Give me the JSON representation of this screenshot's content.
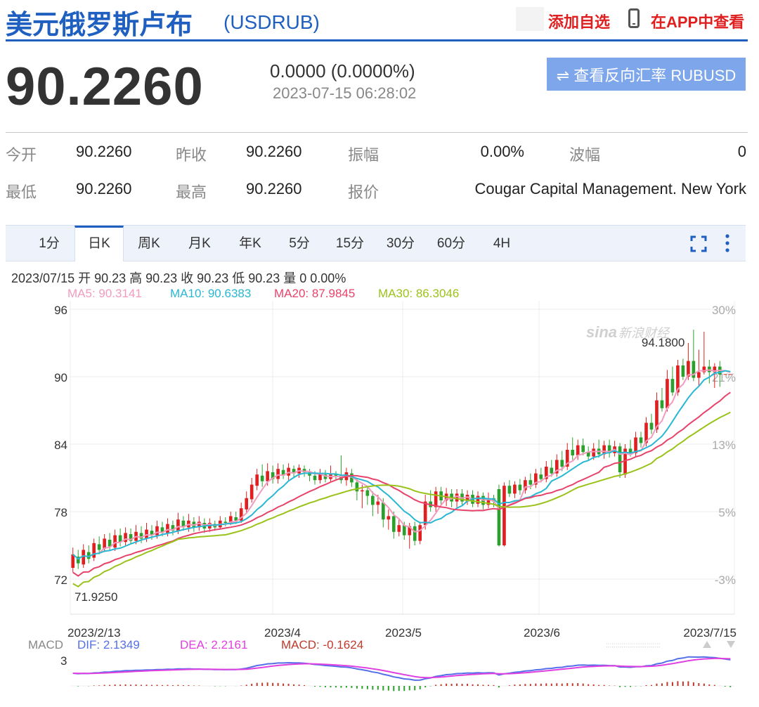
{
  "header": {
    "title": "美元俄罗斯卢布",
    "code": "(USDRUB)",
    "add_watchlist": "添加自选",
    "view_in_app": "在APP中查看"
  },
  "quote": {
    "price": "90.2260",
    "change": "0.0000 (0.0000%)",
    "timestamp": "2023-07-15 06:28:02",
    "reverse_button": "⇌ 查看反向汇率 RUBUSD"
  },
  "stats": [
    {
      "label": "今开",
      "value": "90.2260"
    },
    {
      "label": "昨收",
      "value": "90.2260"
    },
    {
      "label": "振幅",
      "value": "0.00%"
    },
    {
      "label": "波幅",
      "value": "0"
    },
    {
      "label": "最低",
      "value": "90.2260"
    },
    {
      "label": "最高",
      "value": "90.2260"
    },
    {
      "label": "报价",
      "value": "Cougar Capital Management. New York"
    }
  ],
  "tabs": [
    "1分",
    "日K",
    "周K",
    "月K",
    "年K",
    "5分",
    "15分",
    "30分",
    "60分",
    "4H"
  ],
  "active_tab": "日K",
  "info_line": "2023/07/15 开 90.23 高 90.23 收 90.23 低 90.23 量 0 0.00%",
  "ma_labels": [
    {
      "text": "MA5: 90.3141",
      "color": "#f29bbf"
    },
    {
      "text": "MA10: 90.6383",
      "color": "#29b7d3"
    },
    {
      "text": "MA20: 87.9845",
      "color": "#e8436a"
    },
    {
      "text": "MA30: 86.3046",
      "color": "#9bc21a"
    }
  ],
  "macd_labels": {
    "name": "MACD",
    "dif": "DIF: 2.1349",
    "dea": "DEA: 2.2161",
    "macd": "MACD: -0.1624",
    "axis_max": "3"
  },
  "watermark": {
    "logo": "sina",
    "text": "新浪财经"
  },
  "colors": {
    "brand_blue": "#1f5fbf",
    "up": "#e02020",
    "down": "#2ca02c",
    "ma5": "#f29bbf",
    "ma10": "#29b7d3",
    "ma20": "#e8436a",
    "ma30": "#9bc21a",
    "dif": "#5470e8",
    "dea": "#e040e0"
  },
  "chart_data": {
    "type": "candlestick",
    "y_ticks": [
      "96",
      "90",
      "84",
      "78",
      "72"
    ],
    "y_range": [
      69.5,
      96
    ],
    "pct_ticks": [
      "30%",
      "21%",
      "13%",
      "5%",
      "-3%"
    ],
    "x_ticks": [
      "2023/2/13",
      "2023/4",
      "2023/5",
      "2023/6",
      "2023/7/15"
    ],
    "annotations": {
      "max": "94.1800",
      "min": "71.9250"
    },
    "candles": [
      [
        73.0,
        74.2,
        74.8,
        72.6
      ],
      [
        74.0,
        73.4,
        74.6,
        72.9
      ],
      [
        73.3,
        74.6,
        75.1,
        73.0
      ],
      [
        74.4,
        73.8,
        75.0,
        73.4
      ],
      [
        73.9,
        75.2,
        75.6,
        73.6
      ],
      [
        75.1,
        74.6,
        75.8,
        74.2
      ],
      [
        74.7,
        75.6,
        76.0,
        74.4
      ],
      [
        75.5,
        74.9,
        76.1,
        74.6
      ],
      [
        74.8,
        75.9,
        76.4,
        74.5
      ],
      [
        75.9,
        75.3,
        76.5,
        74.9
      ],
      [
        75.3,
        76.1,
        76.6,
        75.0
      ],
      [
        76.0,
        75.4,
        76.5,
        75.1
      ],
      [
        75.4,
        76.2,
        76.8,
        75.1
      ],
      [
        76.1,
        75.6,
        76.7,
        75.2
      ],
      [
        75.6,
        76.4,
        77.0,
        75.3
      ],
      [
        76.3,
        75.9,
        76.8,
        75.5
      ],
      [
        75.9,
        76.7,
        77.2,
        75.6
      ],
      [
        76.6,
        76.1,
        77.1,
        75.8
      ],
      [
        76.1,
        76.9,
        77.4,
        75.8
      ],
      [
        76.8,
        76.3,
        77.2,
        75.9
      ],
      [
        76.3,
        77.3,
        77.9,
        76.0
      ],
      [
        77.2,
        76.6,
        77.6,
        76.3
      ],
      [
        76.6,
        77.2,
        77.8,
        76.2
      ],
      [
        77.1,
        76.6,
        77.5,
        76.2
      ],
      [
        76.6,
        77.1,
        77.6,
        76.3
      ],
      [
        77.0,
        76.5,
        77.4,
        76.1
      ],
      [
        76.5,
        77.0,
        77.4,
        76.2
      ],
      [
        76.9,
        76.6,
        77.2,
        76.3
      ],
      [
        76.6,
        77.2,
        77.6,
        76.4
      ],
      [
        77.1,
        77.0,
        77.5,
        76.7
      ],
      [
        77.0,
        77.6,
        78.0,
        76.8
      ],
      [
        77.5,
        77.2,
        78.0,
        76.9
      ],
      [
        77.2,
        78.3,
        78.8,
        77.0
      ],
      [
        78.2,
        79.2,
        79.8,
        77.9
      ],
      [
        79.1,
        80.4,
        81.0,
        78.8
      ],
      [
        80.3,
        81.3,
        81.8,
        79.9
      ],
      [
        81.2,
        80.7,
        82.2,
        80.2
      ],
      [
        80.7,
        81.6,
        82.3,
        80.3
      ],
      [
        81.5,
        80.9,
        82.1,
        80.5
      ],
      [
        80.9,
        81.8,
        82.3,
        80.5
      ],
      [
        81.7,
        81.2,
        82.2,
        80.9
      ],
      [
        81.2,
        81.9,
        82.3,
        80.8
      ],
      [
        81.8,
        81.4,
        82.1,
        81.0
      ],
      [
        81.4,
        81.9,
        82.2,
        81.0
      ],
      [
        81.8,
        81.5,
        82.1,
        81.1
      ],
      [
        81.5,
        81.2,
        81.8,
        80.7
      ],
      [
        81.2,
        80.8,
        81.6,
        80.4
      ],
      [
        80.8,
        81.4,
        81.8,
        80.5
      ],
      [
        81.3,
        80.9,
        81.7,
        80.6
      ],
      [
        80.9,
        81.3,
        82.1,
        80.6
      ],
      [
        81.3,
        81.2,
        81.6,
        80.8
      ],
      [
        81.2,
        80.8,
        83.0,
        80.5
      ],
      [
        80.8,
        81.5,
        81.9,
        80.3
      ],
      [
        81.4,
        80.6,
        81.8,
        80.2
      ],
      [
        80.6,
        79.8,
        81.0,
        79.0
      ],
      [
        79.8,
        79.9,
        80.4,
        78.3
      ],
      [
        79.9,
        79.4,
        80.3,
        78.6
      ],
      [
        79.4,
        78.6,
        79.8,
        77.6
      ],
      [
        78.6,
        78.9,
        79.5,
        77.8
      ],
      [
        78.8,
        77.3,
        79.2,
        76.6
      ],
      [
        77.3,
        77.6,
        78.2,
        76.4
      ],
      [
        77.6,
        76.2,
        78.0,
        75.6
      ],
      [
        76.2,
        76.8,
        77.3,
        75.8
      ],
      [
        76.8,
        75.9,
        77.1,
        75.5
      ],
      [
        75.9,
        76.7,
        77.0,
        74.7
      ],
      [
        76.7,
        75.4,
        77.1,
        75.0
      ],
      [
        75.4,
        76.8,
        77.1,
        75.1
      ],
      [
        76.8,
        78.9,
        79.5,
        76.4
      ],
      [
        78.9,
        78.4,
        79.9,
        78.0
      ],
      [
        78.4,
        79.8,
        80.2,
        78.0
      ],
      [
        79.8,
        79.0,
        80.2,
        78.6
      ],
      [
        79.0,
        79.6,
        80.1,
        78.5
      ],
      [
        79.6,
        78.9,
        80.0,
        78.4
      ],
      [
        78.9,
        79.6,
        80.0,
        78.4
      ],
      [
        79.6,
        78.9,
        80.0,
        78.5
      ],
      [
        78.9,
        79.5,
        79.9,
        78.6
      ],
      [
        79.5,
        78.7,
        79.9,
        78.4
      ],
      [
        78.7,
        79.4,
        79.8,
        78.4
      ],
      [
        79.4,
        78.6,
        79.7,
        78.2
      ],
      [
        78.6,
        79.2,
        79.7,
        78.3
      ],
      [
        79.2,
        78.9,
        79.5,
        78.4
      ],
      [
        80.0,
        75.0,
        80.4,
        74.9
      ],
      [
        75.0,
        80.3,
        80.6,
        74.9
      ],
      [
        80.3,
        79.6,
        80.8,
        79.3
      ],
      [
        79.6,
        80.4,
        80.7,
        79.2
      ],
      [
        80.4,
        79.9,
        80.9,
        79.5
      ],
      [
        79.9,
        80.8,
        81.1,
        79.6
      ],
      [
        80.8,
        80.4,
        81.4,
        80.0
      ],
      [
        80.4,
        81.4,
        81.8,
        80.1
      ],
      [
        81.3,
        80.9,
        81.9,
        80.6
      ],
      [
        80.9,
        82.0,
        82.5,
        80.6
      ],
      [
        81.9,
        81.4,
        82.6,
        81.1
      ],
      [
        81.4,
        82.6,
        83.1,
        81.1
      ],
      [
        82.6,
        82.0,
        83.4,
        81.6
      ],
      [
        82.0,
        83.5,
        84.1,
        81.7
      ],
      [
        83.5,
        83.0,
        84.6,
        82.6
      ],
      [
        83.0,
        83.9,
        84.4,
        82.6
      ],
      [
        83.9,
        83.3,
        84.5,
        83.0
      ],
      [
        83.3,
        82.9,
        83.8,
        82.5
      ],
      [
        82.9,
        83.6,
        84.1,
        82.6
      ],
      [
        83.6,
        83.1,
        84.4,
        82.8
      ],
      [
        83.1,
        83.9,
        84.3,
        82.7
      ],
      [
        83.9,
        83.2,
        84.4,
        82.8
      ],
      [
        83.2,
        83.8,
        84.3,
        82.9
      ],
      [
        83.8,
        81.5,
        84.1,
        81.0
      ],
      [
        81.3,
        83.6,
        84.0,
        81.0
      ],
      [
        83.6,
        83.2,
        84.4,
        82.9
      ],
      [
        83.2,
        84.6,
        85.1,
        82.9
      ],
      [
        84.6,
        84.1,
        85.1,
        83.7
      ],
      [
        84.1,
        85.9,
        86.4,
        83.8
      ],
      [
        85.9,
        85.3,
        86.7,
        84.9
      ],
      [
        85.3,
        87.9,
        88.6,
        85.0
      ],
      [
        87.9,
        87.2,
        89.0,
        86.9
      ],
      [
        87.2,
        89.8,
        90.6,
        86.9
      ],
      [
        89.8,
        88.6,
        90.9,
        88.3
      ],
      [
        88.6,
        91.0,
        91.5,
        88.3
      ],
      [
        91.0,
        90.0,
        91.6,
        89.7
      ],
      [
        90.0,
        91.4,
        93.0,
        89.7
      ],
      [
        91.4,
        89.9,
        94.18,
        89.6
      ],
      [
        89.9,
        90.4,
        92.4,
        89.2
      ],
      [
        90.4,
        90.9,
        94.0,
        90.2
      ],
      [
        90.9,
        90.4,
        91.5,
        89.4
      ],
      [
        90.4,
        90.9,
        91.2,
        89.0
      ],
      [
        90.9,
        90.2,
        91.4,
        89.1
      ],
      [
        90.23,
        90.23,
        90.23,
        90.23
      ],
      [
        90.23,
        90.23,
        90.23,
        90.23
      ]
    ]
  }
}
